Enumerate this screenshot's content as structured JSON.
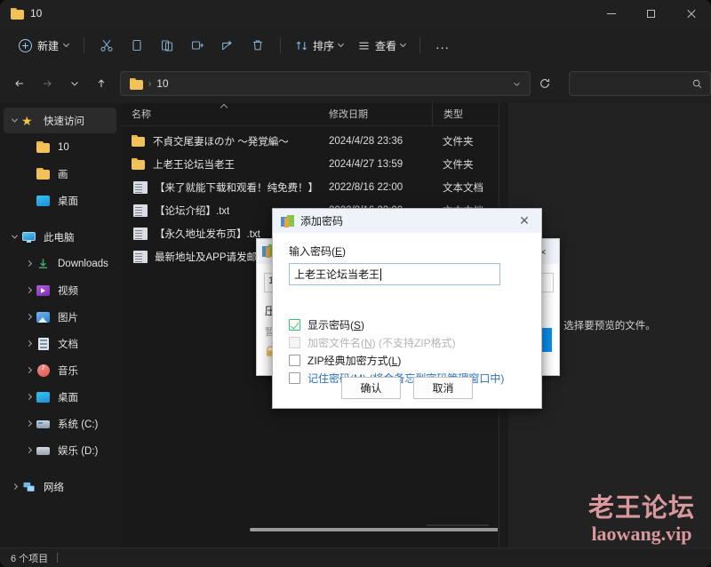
{
  "window": {
    "tab_title": "10",
    "minimize_label": "最小化",
    "maximize_label": "最大化",
    "close_label": "关闭"
  },
  "toolbar": {
    "new_label": "新建",
    "cut_label": "剪切",
    "copy_label": "复制",
    "paste_label": "粘贴",
    "rename_label": "重命名",
    "share_label": "共享",
    "delete_label": "删除",
    "sort_label": "排序",
    "view_label": "查看",
    "more_label": "..."
  },
  "addressbar": {
    "back_label": "后退",
    "forward_label": "前进",
    "recent_label": "最近使用的位置",
    "up_label": "向上",
    "crumb_separator": "›",
    "crumb": "10",
    "refresh_label": "刷新",
    "search_placeholder": ""
  },
  "sidebar": {
    "items": [
      {
        "label": "快速访问",
        "icon": "star-icon",
        "expander": "open",
        "indent": 0,
        "selected": true
      },
      {
        "label": "10",
        "icon": "folder-icon",
        "expander": "none",
        "indent": 1,
        "selected": false
      },
      {
        "label": "画",
        "icon": "folder-icon",
        "expander": "none",
        "indent": 1,
        "selected": false
      },
      {
        "label": "桌面",
        "icon": "desktop-icon",
        "expander": "none",
        "indent": 1,
        "selected": false
      },
      {
        "label": "此电脑",
        "icon": "this-pc-icon",
        "expander": "open",
        "indent": 0,
        "selected": false
      },
      {
        "label": "Downloads",
        "icon": "downloads-icon",
        "expander": "closed",
        "indent": 1,
        "selected": false
      },
      {
        "label": "视频",
        "icon": "videos-icon",
        "expander": "closed",
        "indent": 1,
        "selected": false
      },
      {
        "label": "图片",
        "icon": "pictures-icon",
        "expander": "closed",
        "indent": 1,
        "selected": false
      },
      {
        "label": "文档",
        "icon": "documents-icon",
        "expander": "closed",
        "indent": 1,
        "selected": false
      },
      {
        "label": "音乐",
        "icon": "music-icon",
        "expander": "closed",
        "indent": 1,
        "selected": false
      },
      {
        "label": "桌面",
        "icon": "desktop-icon",
        "expander": "closed",
        "indent": 1,
        "selected": false
      },
      {
        "label": "系统 (C:)",
        "icon": "system-drive-icon",
        "expander": "closed",
        "indent": 1,
        "selected": false
      },
      {
        "label": "娱乐 (D:)",
        "icon": "drive-icon",
        "expander": "closed",
        "indent": 1,
        "selected": false
      },
      {
        "label": "网络",
        "icon": "network-icon",
        "expander": "closed",
        "indent": 0,
        "selected": false
      }
    ]
  },
  "filelist": {
    "columns": [
      "名称",
      "修改日期",
      "类型"
    ],
    "sort_column_index": 0,
    "rows": [
      {
        "name": "不貞交尾妻ほのか ～発覚編～",
        "date": "2024/4/28 23:36",
        "type": "文件夹",
        "icon": "folder-icon"
      },
      {
        "name": "上老王论坛当老王",
        "date": "2024/4/27 13:59",
        "type": "文件夹",
        "icon": "folder-icon"
      },
      {
        "name": "【来了就能下载和观看！纯免费！】.txt",
        "date": "2022/8/16 22:00",
        "type": "文本文档",
        "icon": "text-file-icon"
      },
      {
        "name": "【论坛介绍】.txt",
        "date": "2022/8/16 22:00",
        "type": "文本文档",
        "icon": "text-file-icon"
      },
      {
        "name": "【永久地址发布页】.txt",
        "date": "",
        "type": "",
        "icon": "text-file-icon"
      },
      {
        "name": "最新地址及APP请发邮箱自…",
        "date": "",
        "type": "",
        "icon": "text-file-icon"
      }
    ]
  },
  "preview": {
    "empty_text": "选择要预览的文件。"
  },
  "statusbar": {
    "item_count": "6 个项目"
  },
  "watermark": {
    "line1": "老王论坛",
    "line2": "laowang.vip",
    "color": "#d8989e"
  },
  "background_dialog": {
    "title": "",
    "input_value": "1",
    "label_1": "压",
    "label_2": "暂",
    "close_label": "×"
  },
  "password_dialog": {
    "title": "添加密码",
    "close_label": "✕",
    "input_label_prefix": "输入密码(",
    "input_label_key": "E",
    "input_label_suffix": ")",
    "input_value": "上老王论坛当老王",
    "checkboxes": [
      {
        "label_main": "显示密码(",
        "accel": "S",
        "label_tail": ")",
        "checked": true,
        "disabled": false,
        "style": "normal"
      },
      {
        "label_main": "加密文件名(",
        "accel": "N",
        "label_tail": ") (不支持ZIP格式)",
        "checked": false,
        "disabled": true,
        "style": "normal"
      },
      {
        "label_main": "ZIP经典加密方式(",
        "accel": "L",
        "label_tail": ")",
        "checked": false,
        "disabled": false,
        "style": "normal"
      },
      {
        "label_main": "记住密码(",
        "accel": "M",
        "label_tail": ") (将会备忘到密码管理窗口中)",
        "checked": false,
        "disabled": false,
        "style": "blue"
      }
    ],
    "ok_label": "确认",
    "cancel_label": "取消"
  }
}
